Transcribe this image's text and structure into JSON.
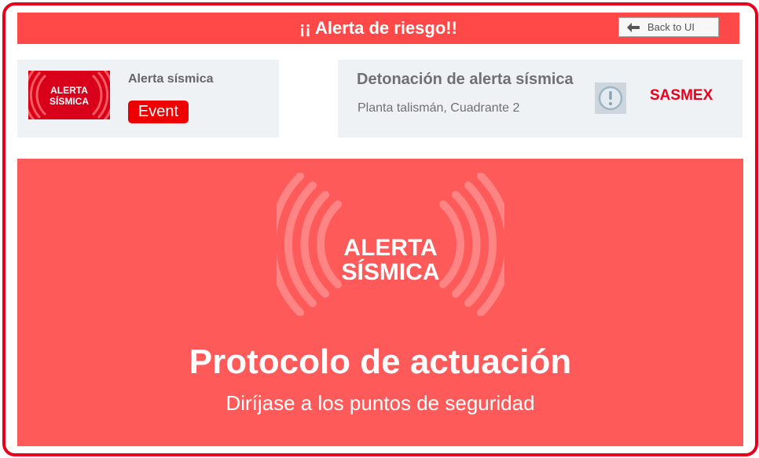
{
  "header": {
    "title": "¡¡ Alerta de riesgo!!",
    "back_label": "Back to UI"
  },
  "event_card": {
    "title": "Alerta sísmica",
    "badge": "Event",
    "logo_text_line1": "ALERTA",
    "logo_text_line2": "SÍSMICA"
  },
  "detail_card": {
    "title": "Detonación de alerta sísmica",
    "location": "Planta talismán, Cuadrante 2",
    "icon": "alert-circle-icon",
    "source": "SASMEX"
  },
  "banner": {
    "logo_line1": "ALERTA",
    "logo_line2": "SÍSMICA",
    "heading": "Protocolo de actuación",
    "subheading": "Diríjase a los puntos de seguridad"
  },
  "colors": {
    "accent_red": "#e8001c",
    "header_bg": "#ff4848",
    "banner_bg": "#ff5a5a",
    "card_bg": "#eef2f5"
  }
}
